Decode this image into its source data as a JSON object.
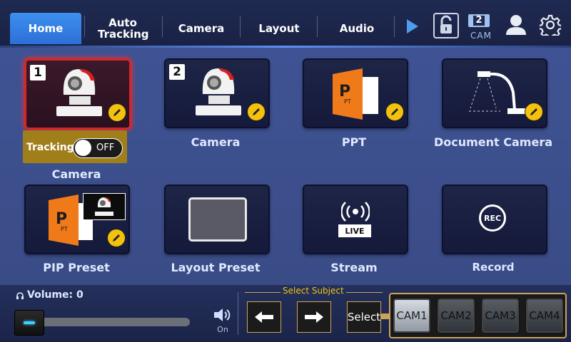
{
  "nav": {
    "tabs": [
      "Home",
      "Auto Tracking",
      "Camera",
      "Layout",
      "Audio"
    ],
    "cam_badge_number": "2",
    "cam_badge_label": "CAM"
  },
  "tiles": {
    "camera1_number": "1",
    "camera1_label": "Camera",
    "camera2_number": "2",
    "camera2_label": "Camera",
    "ppt_label": "PPT",
    "ppt_icon_text": "P",
    "ppt_icon_sub": "PT",
    "document_camera_label": "Document Camera",
    "pip_label": "PIP Preset",
    "pip_icon_text": "P",
    "pip_icon_sub": "PT",
    "layout_label": "Layout Preset",
    "stream_label": "Stream",
    "stream_badge": "LIVE",
    "record_label": "Record",
    "record_badge": "REC"
  },
  "tracking": {
    "label": "Tracking",
    "toggle_state": "OFF"
  },
  "bottom": {
    "volume_label": "Volume: 0",
    "volume_value": 0,
    "speaker_state": "On",
    "select_subject_label": "Select Subject",
    "select_button": "Select",
    "cams": [
      {
        "line1": "CAM",
        "line2": "1"
      },
      {
        "line1": "CAM",
        "line2": "2"
      },
      {
        "line1": "CAM",
        "line2": "3"
      },
      {
        "line1": "CAM",
        "line2": "4"
      }
    ]
  },
  "colors": {
    "accent_blue": "#3d8ff0",
    "selected_red": "#d92525",
    "edit_yellow": "#f4c20d",
    "ppt_orange": "#f07a1a",
    "tracking_gold": "#a07f1a"
  },
  "icons": [
    "play-icon",
    "lock-icon",
    "user-icon",
    "gear-icon",
    "edit-icon",
    "headphones-icon",
    "speaker-icon",
    "arrow-left-icon",
    "arrow-right-icon"
  ]
}
